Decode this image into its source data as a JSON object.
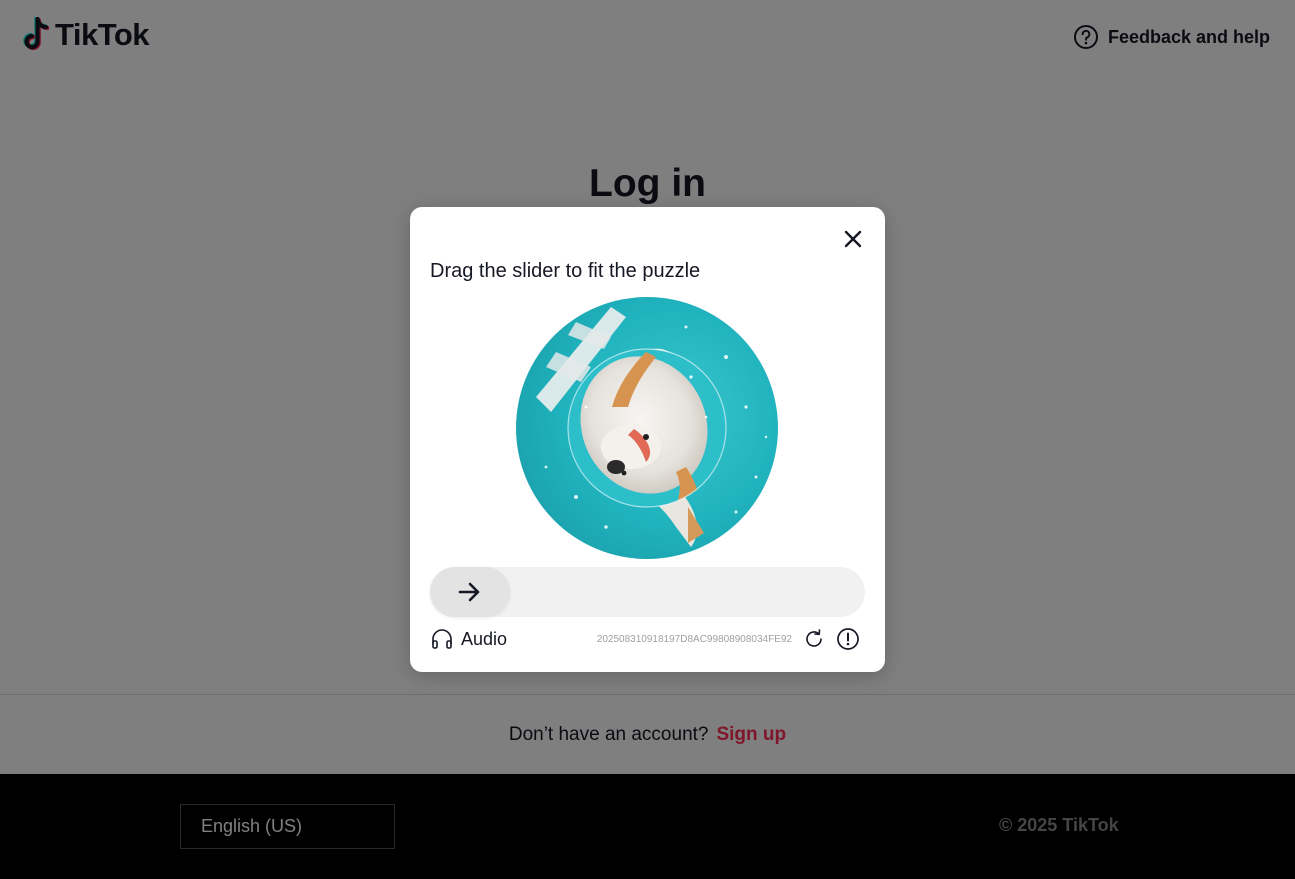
{
  "header": {
    "logo_text": "TikTok",
    "help_label": "Feedback and help"
  },
  "login": {
    "title": "Log in"
  },
  "signup": {
    "prompt": "Don’t have an account?",
    "link": "Sign up"
  },
  "footer": {
    "language": "English (US)",
    "copyright": "© 2025 TikTok"
  },
  "captcha": {
    "title": "Drag the slider to fit the puzzle",
    "audio_label": "Audio",
    "id": "20250831091819‌7D8AC99808908034FE92",
    "slider_progress": 0,
    "icons": {
      "close": "close-icon",
      "slider": "arrow-right-icon",
      "audio": "headphones-icon",
      "refresh": "refresh-icon",
      "report": "alert-circle-icon"
    }
  },
  "colors": {
    "brand_red": "#fe2c55",
    "brand_cyan": "#25f4ee",
    "text_dark": "#161823",
    "puzzle_teal": "#1fb2bd"
  }
}
